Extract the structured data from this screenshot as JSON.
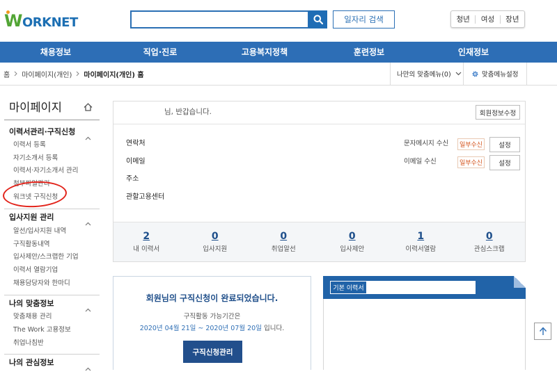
{
  "header": {
    "logo": "WORKNET",
    "search": {
      "value": "",
      "placeholder": ""
    },
    "job_search_label": "일자리 검색",
    "audience_links": [
      "청년",
      "여성",
      "장년"
    ]
  },
  "nav": {
    "items": [
      "채용정보",
      "직업·진로",
      "고용복지정책",
      "훈련정보",
      "인재정보"
    ]
  },
  "breadcrumb": {
    "items": [
      "홈",
      "마이페이지(개인)",
      "마이페이지(개인) 홈"
    ],
    "my_menu_label": "나만의 맞춤메뉴(0)",
    "menu_settings_label": "맞춤메뉴설정"
  },
  "sidebar": {
    "title": "마이페이지",
    "sections": [
      {
        "title": "이력서관리·구직신청",
        "items": [
          "이력서 등록",
          "자기소개서 등록",
          "이력서·자기소개서 관리",
          "첨부파일관리",
          "워크넷 구직신청"
        ]
      },
      {
        "title": "입사지원 관리",
        "items": [
          "알선/입사지원 내역",
          "구직활동내역",
          "입사제안/스크랩한 기업",
          "이력서 열람기업",
          "채용담당자와 한마디"
        ]
      },
      {
        "title": "나의 맞춤정보",
        "items": [
          "맞춤채용 관리",
          "The Work 고용정보",
          "취업나침반"
        ]
      },
      {
        "title": "나의 관심정보"
      }
    ]
  },
  "profile": {
    "greeting": "님, 반갑습니다.",
    "edit_button": "회원정보수정",
    "field_labels": [
      "연락처",
      "이메일",
      "주소",
      "관할고용센터"
    ],
    "sms": {
      "label": "문자메시지 수신",
      "status": "일부수신",
      "button": "설정"
    },
    "email": {
      "label": "이메일 수신",
      "status": "일부수신",
      "button": "설정"
    }
  },
  "stats": [
    {
      "value": 2,
      "label": "내 이력서"
    },
    {
      "value": 0,
      "label": "입사지원"
    },
    {
      "value": 0,
      "label": "취업알선"
    },
    {
      "value": 0,
      "label": "입사제안"
    },
    {
      "value": 1,
      "label": "이력서열람"
    },
    {
      "value": 0,
      "label": "관심스크랩"
    }
  ],
  "job_application": {
    "title": "회원님의 구직신청이 완료되었습니다.",
    "period_intro": "구직활동 가능기간은",
    "period": "2020년 04월 21일 ~ 2020년 07월 20일",
    "period_suffix": "입니다.",
    "manage_button": "구직신청관리"
  },
  "resume": {
    "label": "기본 이력서",
    "title_value": ""
  },
  "icons": {
    "search": "search-icon",
    "breadcrumb_separator": "chevron-right-icon",
    "dropdown": "chevron-down-icon",
    "settings": "gear-icon",
    "home": "home-icon",
    "collapse": "chevron-up-icon",
    "scroll_top": "arrow-up-icon"
  },
  "colors": {
    "nav_blue": "#2d6eb6",
    "brand_blue": "#2a6fb4",
    "dark_blue": "#224f8c",
    "logo_green": "#52a535",
    "badge_orange": "#d4541c",
    "annotation_red": "#e2231a"
  }
}
